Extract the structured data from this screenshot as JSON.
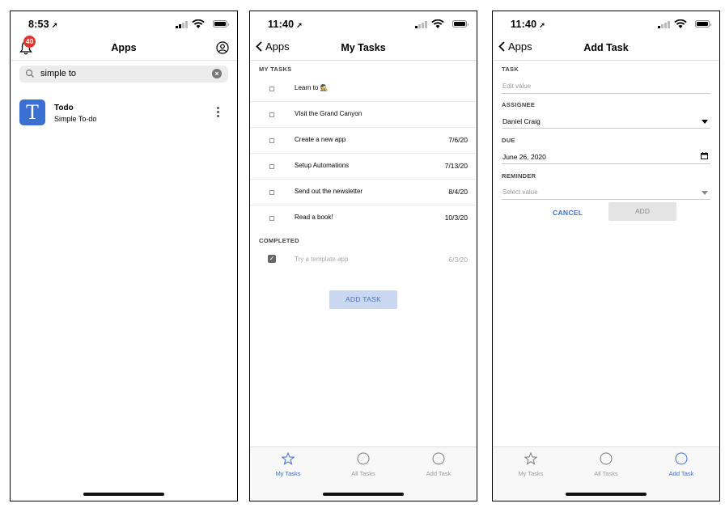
{
  "screen1": {
    "status": {
      "time": "8:53"
    },
    "header": {
      "title": "Apps",
      "notification_count": "40"
    },
    "search": {
      "value": "simple to"
    },
    "app": {
      "letter": "T",
      "name": "Todo",
      "subtitle": "Simple To-do"
    }
  },
  "screen2": {
    "status": {
      "time": "11:40"
    },
    "header": {
      "back_label": "Apps",
      "title": "My Tasks"
    },
    "sections": {
      "my_tasks": "MY TASKS",
      "completed": "COMPLETED"
    },
    "tasks": [
      {
        "name": "Learn to 🕵",
        "date": ""
      },
      {
        "name": "VIsit the Grand Canyon",
        "date": ""
      },
      {
        "name": "Create a new app",
        "date": "7/6/20"
      },
      {
        "name": "Setup Automations",
        "date": "7/13/20"
      },
      {
        "name": "Send out the newsletter",
        "date": "8/4/20"
      },
      {
        "name": "Read a book!",
        "date": "10/3/20"
      }
    ],
    "completed": [
      {
        "name": "Try a template app",
        "date": "6/3/20"
      }
    ],
    "add_task_label": "ADD TASK",
    "tabs": [
      {
        "label": "My Tasks",
        "icon": "star-icon"
      },
      {
        "label": "All Tasks",
        "icon": "circle-icon"
      },
      {
        "label": "Add Task",
        "icon": "circle-icon"
      }
    ]
  },
  "screen3": {
    "status": {
      "time": "11:40"
    },
    "header": {
      "back_label": "Apps",
      "title": "Add Task"
    },
    "form": {
      "task_label": "TASK",
      "task_placeholder": "Edit value",
      "assignee_label": "ASSIGNEE",
      "assignee_value": "Daniel Craig",
      "due_label": "DUE",
      "due_value": "June 26, 2020",
      "reminder_label": "REMINDER",
      "reminder_placeholder": "Select value"
    },
    "cancel_label": "CANCEL",
    "add_label": "ADD",
    "tabs": [
      {
        "label": "My Tasks",
        "icon": "star-icon"
      },
      {
        "label": "All Tasks",
        "icon": "circle-icon"
      },
      {
        "label": "Add Task",
        "icon": "circle-icon"
      }
    ]
  },
  "colors": {
    "accent": "#3b6fd2",
    "badge": "#e3342f",
    "add_button_bg": "#c9d7f0"
  }
}
